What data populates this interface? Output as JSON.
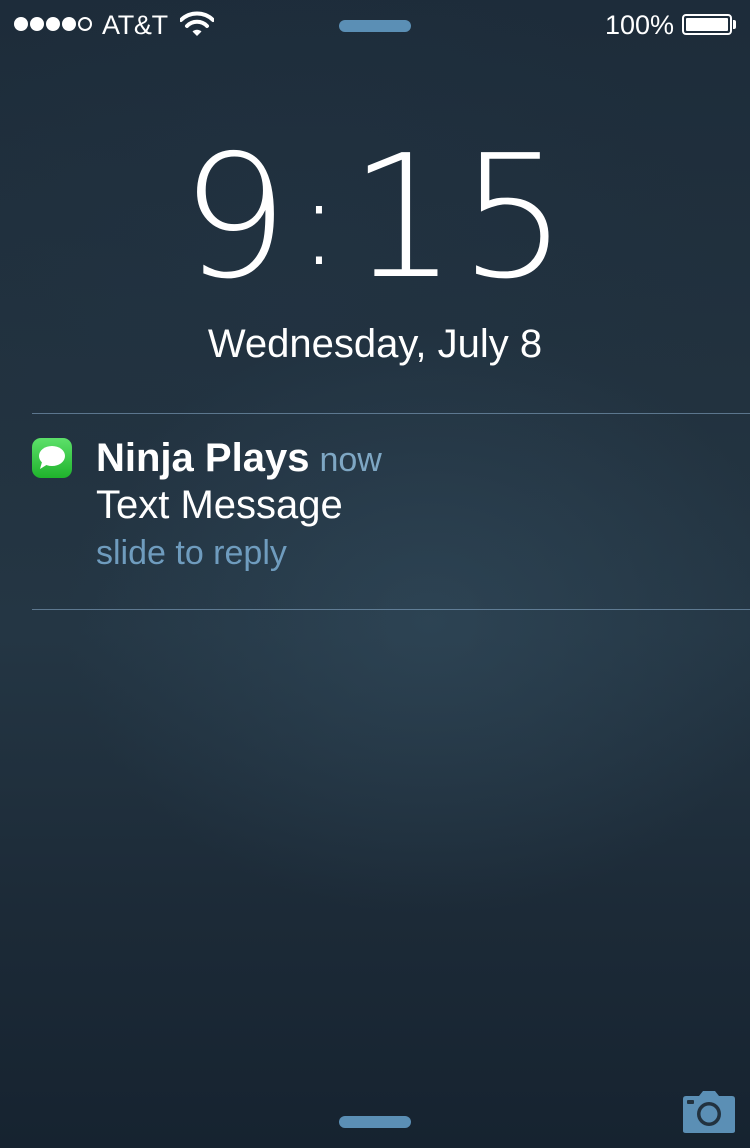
{
  "status_bar": {
    "carrier": "AT&T",
    "signal_bars_filled": 4,
    "signal_bars_total": 5,
    "battery_text": "100%",
    "battery_level": 1.0,
    "wifi_icon": "wifi-icon"
  },
  "lockscreen": {
    "time_hours": "9",
    "time_colon": ":",
    "time_minutes": "15",
    "date": "Wednesday, July 8"
  },
  "notification": {
    "app_icon": "messages-icon",
    "sender": "Ninja Plays",
    "time": "now",
    "body": "Text Message",
    "action": "slide to reply"
  },
  "bottom": {
    "camera_icon": "camera-icon"
  },
  "colors": {
    "accent": "#5b8fb5",
    "secondary_text": "#7ea7c4",
    "messages_green": "#1fb32c"
  }
}
